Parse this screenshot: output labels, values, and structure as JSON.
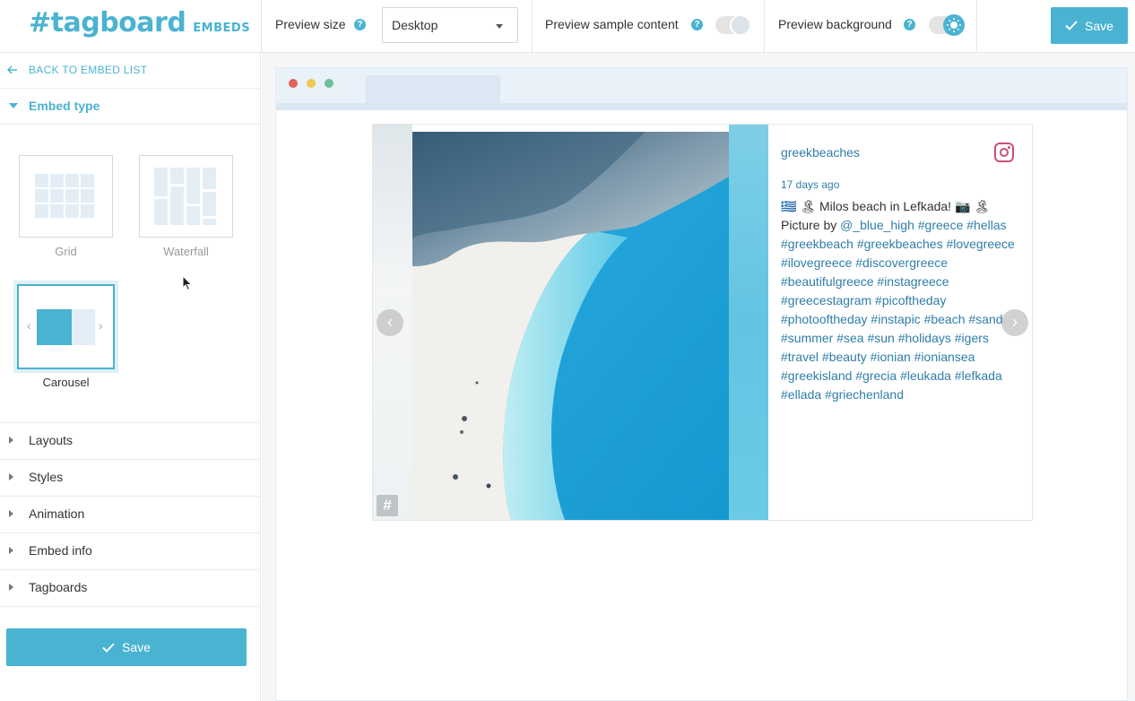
{
  "brand": {
    "logo": "#tagboard",
    "logo_sub": "EMBEDS",
    "accent": "#4ab3d1"
  },
  "topbar": {
    "preview_size_label": "Preview size",
    "preview_size_value": "Desktop",
    "sample_content_label": "Preview sample content",
    "background_label": "Preview background",
    "save_label": "Save"
  },
  "sidebar": {
    "back_label": "BACK TO EMBED LIST",
    "embed_type_label": "Embed type",
    "types": [
      {
        "label": "Grid"
      },
      {
        "label": "Waterfall"
      },
      {
        "label": "Carousel"
      }
    ],
    "selected_type": "Carousel",
    "sections": [
      {
        "label": "Layouts"
      },
      {
        "label": "Styles"
      },
      {
        "label": "Animation"
      },
      {
        "label": "Embed info"
      },
      {
        "label": "Tagboards"
      }
    ],
    "save_label": "Save"
  },
  "post": {
    "handle": "greekbeaches",
    "time": "17 days ago",
    "text_prefix": "🇬🇷 🏝 Milos beach in Lefkada! 📷 🏝",
    "picture_by": "Picture by",
    "mention": "@_blue_high",
    "hashtags_line1": "#greece #hellas",
    "hashtags_rest": "#greekbeach #greekbeaches #lovegreece #ilovegreece #discovergreece #beautifulgreece #instagreece #greecestagram #picoftheday #photooftheday #instapic #beach #sand #summer #sea #sun #holidays #igers #travel #beauty #ionian #ioniansea #greekisland #grecia #leukada #lefkada #ellada #griechenland"
  }
}
